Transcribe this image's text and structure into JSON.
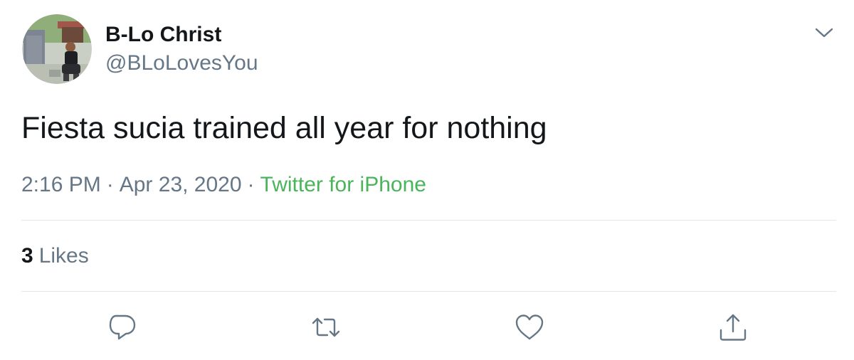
{
  "user": {
    "display_name": "B-Lo Christ",
    "handle": "@BLoLovesYou"
  },
  "tweet": {
    "text": "Fiesta sucia trained all year for nothing",
    "time": "2:16 PM",
    "date": "Apr 23, 2020",
    "separator": "·",
    "source": "Twitter for iPhone"
  },
  "stats": {
    "likes_count": "3",
    "likes_label": "Likes"
  },
  "icons": {
    "menu": "chevron-down-icon",
    "reply": "reply-icon",
    "retweet": "retweet-icon",
    "like": "heart-icon",
    "share": "share-icon"
  },
  "colors": {
    "text_primary": "#14171a",
    "text_secondary": "#657786",
    "source_link": "#4ab45b",
    "divider": "#e1e8ed",
    "icon": "#657786"
  }
}
